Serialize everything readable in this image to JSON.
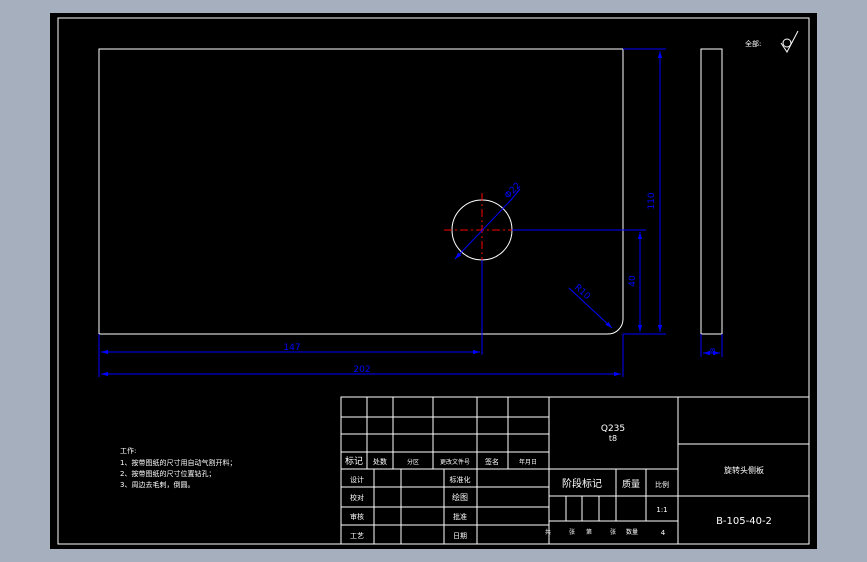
{
  "colors": {
    "background": "#a6afbd",
    "paper": "#000000",
    "outline": "#ffffff",
    "dimension": "#0000ff",
    "centerline": "#ff0000"
  },
  "roughness_symbol": {
    "label": "全部:"
  },
  "dimensions": {
    "hole_diameter": "Φ22",
    "height": "110",
    "hole_offset_y": "40",
    "corner_radius": "R10",
    "hole_offset_x": "147",
    "width": "202",
    "thickness": "8"
  },
  "notes": {
    "heading": "工作:",
    "items": [
      "1、按带图纸的尺寸用自动气割开料；",
      "2、按带图纸的尺寸位置钻孔；",
      "3、周边去毛刺，倒圆。"
    ]
  },
  "title_block": {
    "material": "Q235",
    "material_thickness": "t8",
    "part_name": "旋转头侧板",
    "drawing_number": "B-105-40-2",
    "scale": "1:1",
    "quantity": "4",
    "revision_headers": [
      "标记",
      "处数",
      "分区",
      "更改文件号",
      "签名",
      "年月日"
    ],
    "sign_rows": [
      {
        "role": "设计",
        "mid": "标准化"
      },
      {
        "role": "校对",
        "mid": "绘图"
      },
      {
        "role": "审核",
        "mid": "批准"
      },
      {
        "role": "工艺",
        "mid": "日期"
      }
    ],
    "stage_label": "阶段标记",
    "mass_label": "质量",
    "scale_label": "比例",
    "sheet_labels": [
      "共",
      "张",
      "第",
      "张",
      "数量"
    ]
  }
}
